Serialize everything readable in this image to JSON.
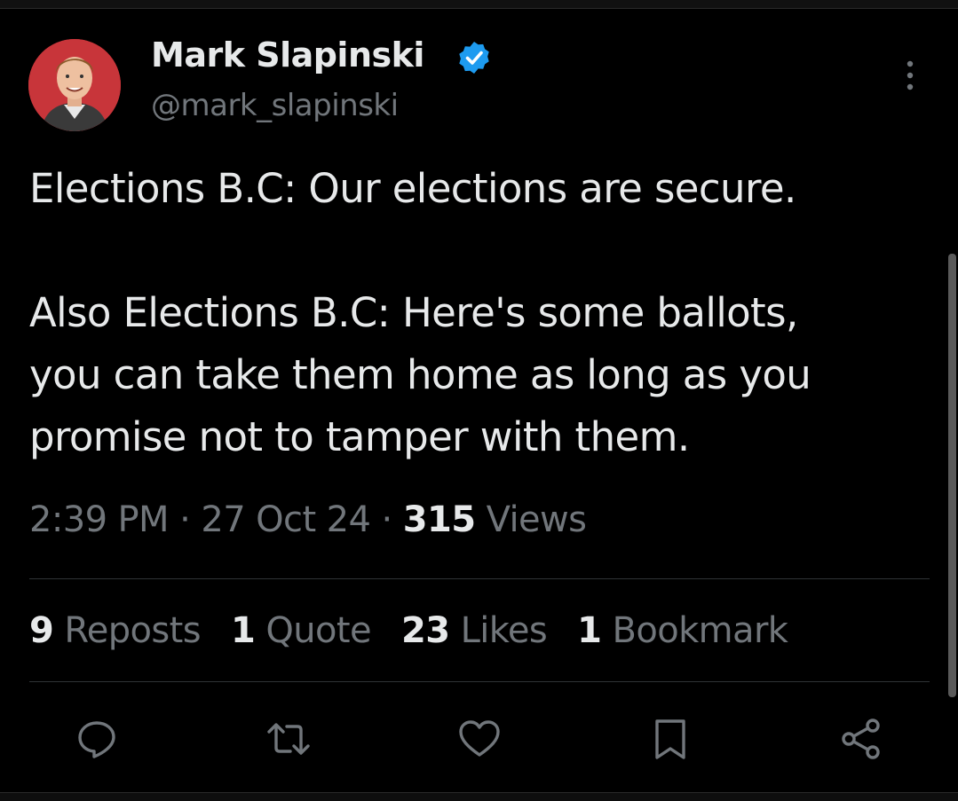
{
  "author": {
    "display_name": "Mark Slapinski",
    "handle": "@mark_slapinski",
    "verified": true
  },
  "tweet": {
    "paragraphs": [
      "Elections B.C: Our elections are secure.",
      "Also Elections B.C: Here's some ballots,\nyou can take them home as long as you\npromise not to tamper with them."
    ]
  },
  "meta": {
    "time": "2:39 PM",
    "separator": "·",
    "date": "27 Oct 24",
    "views_count": "315",
    "views_label": "Views"
  },
  "stats": {
    "reposts_count": "9",
    "reposts_label": "Reposts",
    "quotes_count": "1",
    "quotes_label": "Quote",
    "likes_count": "23",
    "likes_label": "Likes",
    "bookmarks_count": "1",
    "bookmarks_label": "Bookmark"
  },
  "actions": [
    "reply-icon",
    "repost-icon",
    "like-icon",
    "bookmark-icon",
    "share-icon"
  ],
  "colors": {
    "background": "#000000",
    "primary_text": "#e7e9ea",
    "secondary_text": "#71767b",
    "divider": "#2f3336",
    "verified_blue": "#1d9bf0",
    "avatar_bg": "#c8353a"
  }
}
